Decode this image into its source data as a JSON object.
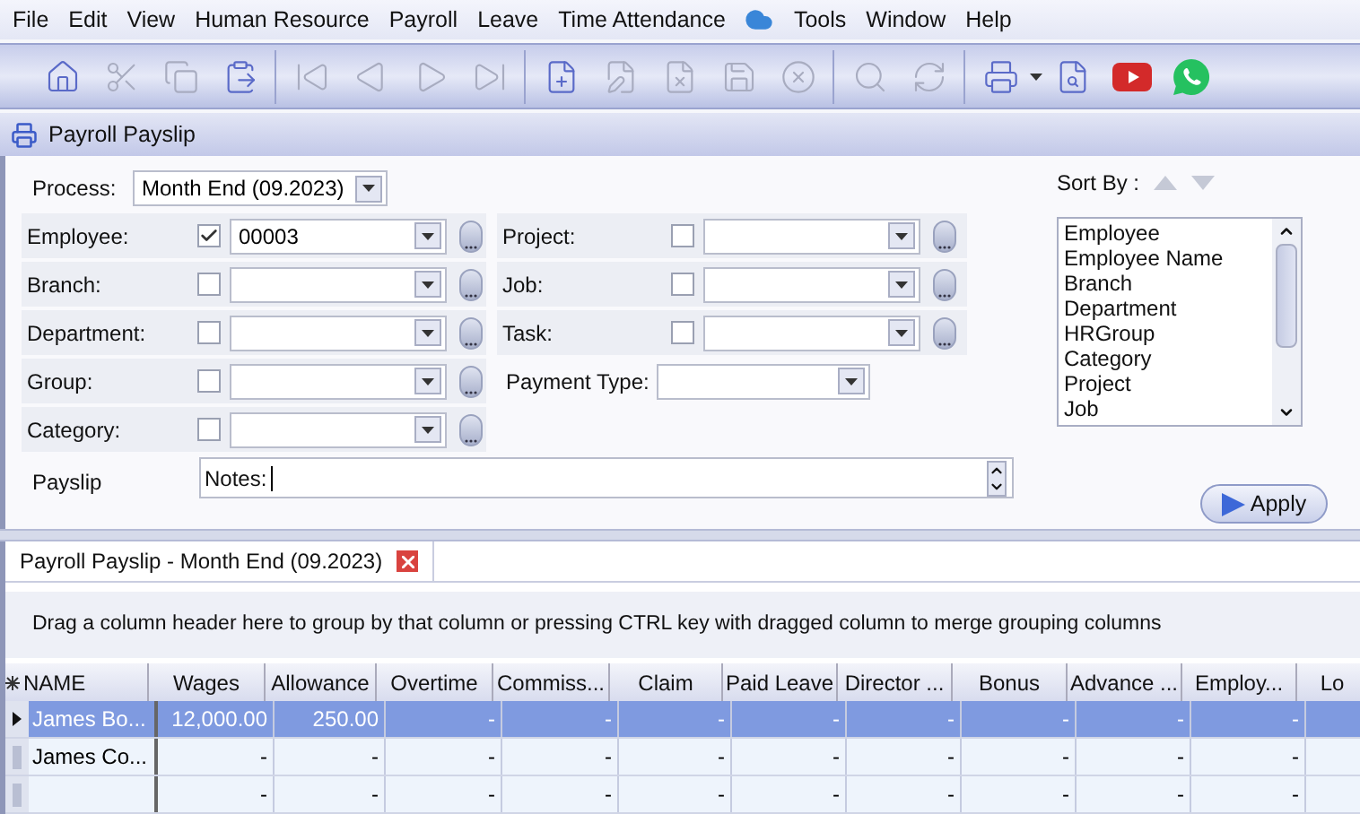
{
  "menu": {
    "items": [
      "File",
      "Edit",
      "View",
      "Human Resource",
      "Payroll",
      "Leave",
      "Time Attendance",
      "Tools",
      "Window",
      "Help"
    ]
  },
  "toolbar": [
    {
      "disabled": false
    },
    {
      "disabled": true
    },
    {
      "disabled": true
    },
    {
      "disabled": false
    },
    {
      "disabled": true
    },
    {
      "disabled": true
    },
    {
      "disabled": true
    },
    {
      "disabled": true
    },
    {
      "disabled": false
    },
    {
      "disabled": true
    },
    {
      "disabled": true
    },
    {
      "disabled": true
    },
    {
      "disabled": true
    },
    {
      "disabled": true
    },
    {
      "disabled": true
    },
    {
      "disabled": false
    },
    {
      "disabled": false
    },
    {
      "disabled": false
    },
    {
      "disabled": false
    }
  ],
  "window": {
    "title": "Payroll Payslip"
  },
  "process": {
    "label": "Process:",
    "value": "Month End (09.2023)"
  },
  "filters": [
    {
      "left": {
        "label": "Employee:",
        "checked": true,
        "value": "00003"
      },
      "right": {
        "kind": "lookup",
        "label": "Project:",
        "checked": false
      }
    },
    {
      "left": {
        "label": "Branch:",
        "checked": false
      },
      "right": {
        "kind": "lookup",
        "label": "Job:",
        "checked": false
      }
    },
    {
      "left": {
        "label": "Department:",
        "checked": false
      },
      "right": {
        "kind": "lookup",
        "label": "Task:",
        "checked": false
      }
    },
    {
      "left": {
        "label": "Group:",
        "checked": false
      },
      "right": {
        "kind": "select",
        "label": "Payment Type:"
      }
    },
    {
      "left": {
        "label": "Category:",
        "checked": false
      }
    }
  ],
  "payslip": {
    "label": "Payslip",
    "value": "Notes:"
  },
  "sort": {
    "label": "Sort By :",
    "items": [
      "Employee",
      "Employee Name",
      "Branch",
      "Department",
      "HRGroup",
      "Category",
      "Project",
      "Job"
    ]
  },
  "apply_button": "Apply",
  "tab": {
    "title": "Payroll Payslip - Month End (09.2023)"
  },
  "group_hint": "Drag a column header here to group by that column or pressing CTRL key with dragged column to merge grouping columns",
  "table": {
    "columns": [
      "NAME",
      "Wages",
      "Allowance",
      "Overtime",
      "Commiss...",
      "Claim",
      "Paid Leave",
      "Director ...",
      "Bonus",
      "Advance ...",
      "Employ...",
      "Lo"
    ],
    "rows": [
      {
        "selected": true,
        "cells": [
          "James Bo...",
          "12,000.00",
          "250.00",
          "-",
          "-",
          "-",
          "-",
          "-",
          "-",
          "-",
          "-"
        ]
      },
      {
        "selected": false,
        "cells": [
          "James Co...",
          "-",
          "-",
          "-",
          "-",
          "-",
          "-",
          "-",
          "-",
          "-",
          "-"
        ]
      },
      {
        "selected": false,
        "cells": [
          "",
          "-",
          "-",
          "-",
          "-",
          "-",
          "-",
          "-",
          "-",
          "-",
          "-"
        ]
      }
    ]
  }
}
